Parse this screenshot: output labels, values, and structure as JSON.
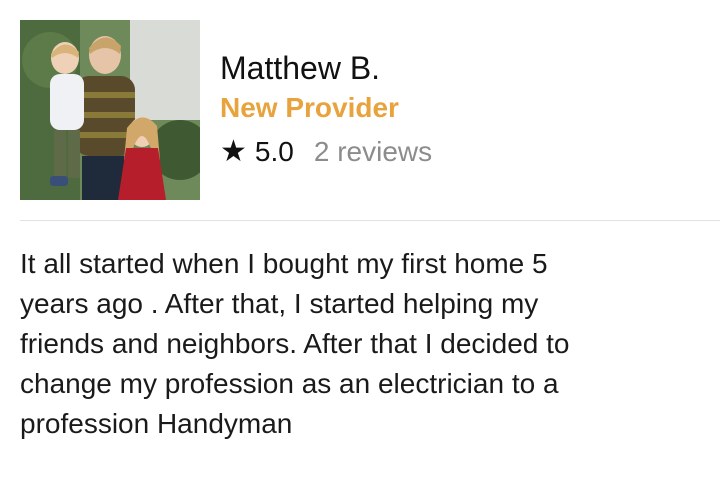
{
  "provider": {
    "name": "Matthew B.",
    "badge": "New Provider",
    "rating": "5.0",
    "reviews": "2 reviews",
    "star_icon": "star-icon",
    "badge_color": "#e8a33d"
  },
  "bio": {
    "text": "It all started when I bought my first home 5\nyears ago .  After that, I started helping my\nfriends and neighbors.  After that I decided to\nchange my profession as an electrician to a\nprofession Handyman"
  }
}
